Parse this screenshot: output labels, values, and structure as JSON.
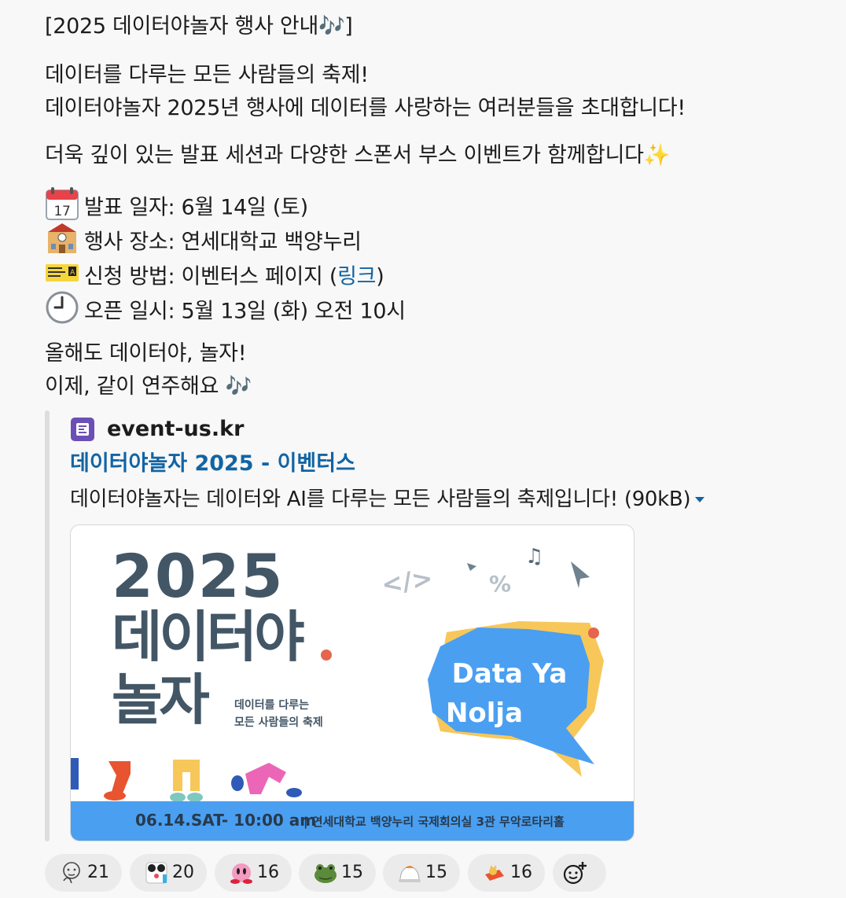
{
  "message": {
    "title": "[2025 데이터야놀자 행사 안내🎶]",
    "intro1": "데이터를 다루는 모든 사람들의 축제!",
    "intro2": "데이터야놀자 2025년 행사에 데이터를 사랑하는 여러분들을 초대합니다!",
    "intro3": "더욱 깊이 있는 발표 세션과 다양한 스폰서 부스 이벤트가 함께합니다✨",
    "details": [
      {
        "icon": "calendar-icon",
        "text": "발표 일자: 6월 14일 (토)"
      },
      {
        "icon": "school-building-icon",
        "text": "행사 장소: 연세대학교 백양누리"
      },
      {
        "icon": "concert-ticket-icon",
        "text_before": "신청 방법: 이벤터스 페이지 (",
        "link": "링크",
        "text_after": ")"
      },
      {
        "icon": "clock-icon",
        "text": "오픈 일시: 5월 13일 (화) 오전 10시"
      }
    ],
    "outro1": "올해도 데이터야, 놀자!",
    "outro2": "이제, 같이 연주해요 🎶"
  },
  "attachment": {
    "site": "event-us.kr",
    "title": "데이터야놀자 2025 - 이벤터스",
    "description": "데이터야놀자는 데이터와 AI를 다루는 모든 사람들의 축제입니다! (90kB)",
    "preview": {
      "year": "2025",
      "main1": "데이터야",
      "main2": "놀자",
      "sub1": "데이터를 다루는",
      "sub2": "모든 사람들의 축제",
      "bubble1": "Data Ya",
      "bubble2": "Nolja",
      "code_symbol": "</>",
      "percent_symbol": "%",
      "date": "06.14.SAT- 10:00 am",
      "venue": "| 연세대학교 백양누리 국제회의실 3관 무악로타리홀"
    }
  },
  "reactions": [
    {
      "icon": "thinking-face-icon",
      "count": "21"
    },
    {
      "icon": "panda-icon",
      "count": "20"
    },
    {
      "icon": "kirby-icon",
      "count": "16"
    },
    {
      "icon": "frog-icon",
      "count": "15"
    },
    {
      "icon": "cat-icon",
      "count": "15"
    },
    {
      "icon": "cat-box-icon",
      "count": "16"
    }
  ],
  "colors": {
    "link": "#1264a3",
    "band": "#4a9ff1",
    "poster_text": "#435666"
  }
}
